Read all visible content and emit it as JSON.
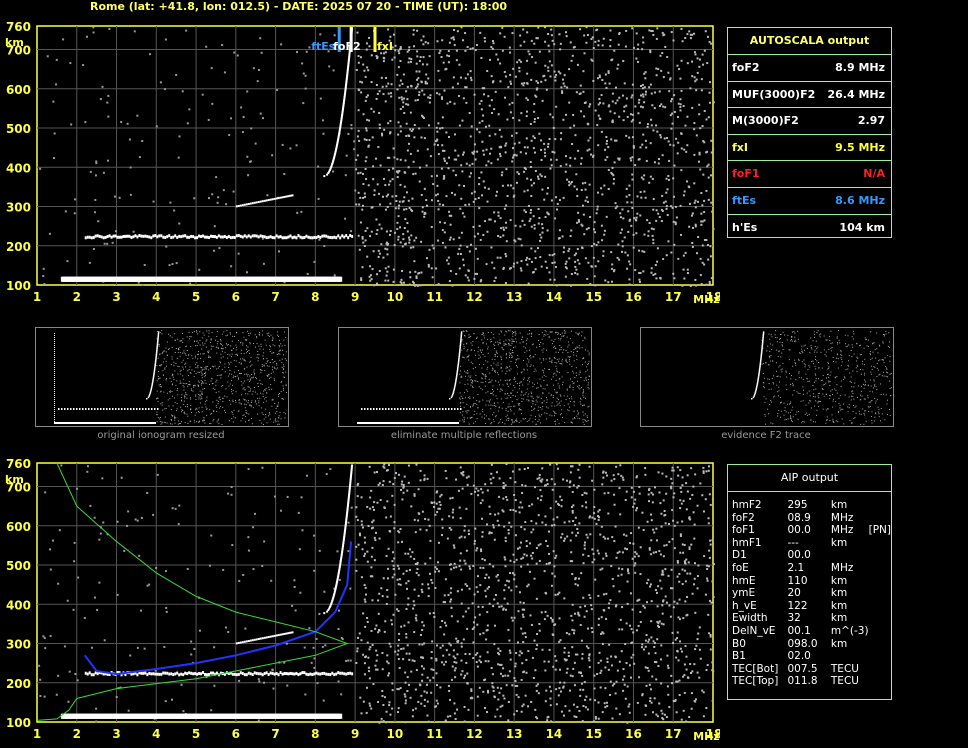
{
  "header": {
    "text": "Rome (lat: +41.8, lon: 012.5) - DATE: 2025 07 20 - TIME (UT): 18:00"
  },
  "autoscala": {
    "title": "AUTOSCALA output",
    "rows": [
      {
        "label": "foF2",
        "value": "8.9 MHz",
        "color": "#ffffff"
      },
      {
        "label": "MUF(3000)F2",
        "value": "26.4 MHz",
        "color": "#ffffff"
      },
      {
        "label": "M(3000)F2",
        "value": "2.97",
        "color": "#ffffff"
      },
      {
        "label": "fxI",
        "value": "9.5 MHz",
        "color": "#ffff44"
      },
      {
        "label": "foF1",
        "value": "N/A",
        "color": "#ff2020"
      },
      {
        "label": "ftEs",
        "value": "8.6 MHz",
        "color": "#3399ff"
      },
      {
        "label": "h'Es",
        "value": "104     km",
        "color": "#ffffff"
      }
    ]
  },
  "aip": {
    "title": "AIP output",
    "rows": [
      {
        "label": "hmF2",
        "value": "295",
        "unit": "km",
        "extra": ""
      },
      {
        "label": "foF2",
        "value": "08.9",
        "unit": "MHz",
        "extra": ""
      },
      {
        "label": "foF1",
        "value": "00.0",
        "unit": "MHz",
        "extra": "[PN]"
      },
      {
        "label": "hmF1",
        "value": "---",
        "unit": "km",
        "extra": ""
      },
      {
        "label": "D1",
        "value": "00.0",
        "unit": "",
        "extra": ""
      },
      {
        "label": "foE",
        "value": "2.1",
        "unit": "MHz",
        "extra": ""
      },
      {
        "label": "hmE",
        "value": "110",
        "unit": "km",
        "extra": ""
      },
      {
        "label": "ymE",
        "value": "20",
        "unit": "km",
        "extra": ""
      },
      {
        "label": "h_vE",
        "value": "122",
        "unit": "km",
        "extra": ""
      },
      {
        "label": "Ewidth",
        "value": "32",
        "unit": "km",
        "extra": ""
      },
      {
        "label": "DelN_vE",
        "value": "00.1",
        "unit": "m^(-3)",
        "extra": ""
      },
      {
        "label": "B0",
        "value": "098.0",
        "unit": "km",
        "extra": ""
      },
      {
        "label": "B1",
        "value": "02.0",
        "unit": "",
        "extra": ""
      },
      {
        "label": "TEC[Bot]",
        "value": "007.5",
        "unit": "TECU",
        "extra": ""
      },
      {
        "label": "TEC[Top]",
        "value": "011.8",
        "unit": "TECU",
        "extra": ""
      }
    ]
  },
  "thumbnails": [
    {
      "caption": "original ionogram resized"
    },
    {
      "caption": "eliminate multiple reflections"
    },
    {
      "caption": "evidence F2 trace"
    }
  ],
  "markers": {
    "ftEs": "ftEs",
    "foF2": "foF2",
    "fxI": "fxI"
  },
  "chart_data": [
    {
      "type": "scatter",
      "xlabel": "MHz",
      "ylabel": "km",
      "xlim": [
        1,
        18
      ],
      "ylim": [
        100,
        760
      ],
      "x_ticks": [
        1,
        2,
        3,
        4,
        5,
        6,
        7,
        8,
        9,
        10,
        11,
        12,
        13,
        14,
        15,
        16,
        17,
        18
      ],
      "y_ticks": [
        100,
        200,
        300,
        400,
        500,
        600,
        700,
        760
      ],
      "grid": true,
      "series": [
        {
          "color": "#ffffff",
          "points": [
            [
              1.6,
              120
            ],
            [
              3,
              120
            ],
            [
              5,
              120
            ],
            [
              7,
              120
            ],
            [
              8.5,
              120
            ],
            [
              2.2,
              222
            ],
            [
              4,
              222
            ],
            [
              6,
              222
            ],
            [
              8.7,
              225
            ],
            [
              6,
              303
            ],
            [
              7,
              330
            ],
            [
              8.5,
              520
            ],
            [
              8.9,
              680
            ],
            [
              7.5,
              740
            ]
          ]
        }
      ],
      "vlines": [
        {
          "label": "ftEs",
          "x": 8.6,
          "color": "#3399ff"
        },
        {
          "label": "foF2",
          "x": 8.9,
          "color": "#ffffff"
        },
        {
          "label": "fxI",
          "x": 9.5,
          "color": "#ffff44"
        }
      ]
    },
    {
      "type": "line",
      "xlabel": "MHz",
      "ylabel": "km",
      "xlim": [
        1,
        18
      ],
      "ylim": [
        100,
        760
      ],
      "x_ticks": [
        1,
        2,
        3,
        4,
        5,
        6,
        7,
        8,
        9,
        10,
        11,
        12,
        13,
        14,
        15,
        16,
        17,
        18
      ],
      "y_ticks": [
        100,
        200,
        300,
        400,
        500,
        600,
        700,
        760
      ],
      "grid": true,
      "series": [
        {
          "color": "#2233ff",
          "points": [
            [
              2.2,
              270
            ],
            [
              2.5,
              230
            ],
            [
              3,
              222
            ],
            [
              4,
              235
            ],
            [
              5,
              250
            ],
            [
              6,
              270
            ],
            [
              7,
              295
            ],
            [
              8,
              330
            ],
            [
              8.5,
              380
            ],
            [
              8.8,
              450
            ],
            [
              8.9,
              560
            ]
          ]
        },
        {
          "color": "#33dd33",
          "points": [
            [
              1.5,
              760
            ],
            [
              2,
              650
            ],
            [
              3,
              560
            ],
            [
              4,
              480
            ],
            [
              5,
              420
            ],
            [
              6,
              380
            ],
            [
              7,
              355
            ],
            [
              8,
              330
            ],
            [
              8.8,
              300
            ],
            [
              8,
              270
            ],
            [
              7,
              250
            ],
            [
              6,
              230
            ],
            [
              5,
              210
            ],
            [
              3,
              185
            ],
            [
              2,
              160
            ],
            [
              1.8,
              130
            ],
            [
              1.5,
              108
            ],
            [
              1,
              104
            ]
          ]
        }
      ]
    }
  ]
}
